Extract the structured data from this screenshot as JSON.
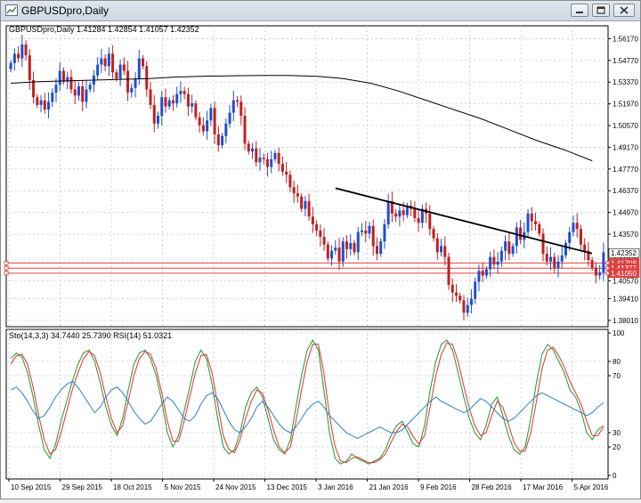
{
  "window": {
    "title": "GBPUSDpro,Daily",
    "controls": {
      "minimize": "minimize",
      "restore": "restore",
      "close": "close"
    }
  },
  "chart_data": [
    {
      "type": "candlestick",
      "symbol": "GBPUSDpro,Daily",
      "ohlc_label": "GBPUSDpro,Daily  1.41284 1.42854 1.41057 1.42352",
      "y_ticks": [
        "1.56170",
        "1.54770",
        "1.53370",
        "1.51970",
        "1.50570",
        "1.49170",
        "1.47770",
        "1.46370",
        "1.44970",
        "1.43570",
        "1.41970",
        "1.40570",
        "1.39410",
        "1.38010"
      ],
      "y_tick_values": [
        1.5617,
        1.5477,
        1.5337,
        1.5197,
        1.5057,
        1.4917,
        1.4777,
        1.4637,
        1.4497,
        1.4357,
        1.4197,
        1.4057,
        1.3941,
        1.3801
      ],
      "ylim": [
        1.376,
        1.57
      ],
      "x_ticks": [
        "10 Sep 2015",
        "29 Sep 2015",
        "18 Oct 2015",
        "5 Nov 2015",
        "24 Nov 2015",
        "13 Dec 2015",
        "3 Jan 2016",
        "21 Jan 2016",
        "9 Feb 2016",
        "28 Feb 2016",
        "17 Mar 2016",
        "5 Apr 2016"
      ],
      "price_labels": [
        {
          "text": "1.42352",
          "value": 1.42352,
          "color": "#000000"
        },
        {
          "text": "1.41708",
          "value": 1.41708,
          "color": "#e04040"
        },
        {
          "text": "1.41377",
          "value": 1.41377,
          "color": "#e04040"
        },
        {
          "text": "1.41050",
          "value": 1.4105,
          "color": "#e04040"
        }
      ],
      "horizontal_lines": [
        1.41708,
        1.41377,
        1.4105
      ],
      "trendline": {
        "from": {
          "x": "21 Jan 2016",
          "y": 1.4653
        },
        "to": {
          "x": "22 Apr 2016",
          "y": 1.4232
        }
      },
      "moving_average": [
        1.533,
        1.534,
        1.5345,
        1.535,
        1.5355,
        1.536,
        1.537,
        1.5375,
        1.5378,
        1.538,
        1.538,
        1.5375,
        1.536,
        1.533,
        1.528,
        1.522,
        1.516,
        1.51,
        1.503,
        1.496,
        1.49,
        1.483
      ],
      "closes": [
        1.546,
        1.552,
        1.549,
        1.558,
        1.551,
        1.535,
        1.524,
        1.519,
        1.522,
        1.516,
        1.521,
        1.527,
        1.532,
        1.541,
        1.534,
        1.537,
        1.529,
        1.525,
        1.531,
        1.521,
        1.529,
        1.532,
        1.538,
        1.545,
        1.549,
        1.544,
        1.552,
        1.54,
        1.536,
        1.545,
        1.541,
        1.527,
        1.53,
        1.536,
        1.549,
        1.544,
        1.529,
        1.519,
        1.507,
        1.512,
        1.524,
        1.518,
        1.522,
        1.52,
        1.526,
        1.528,
        1.526,
        1.518,
        1.52,
        1.511,
        1.506,
        1.502,
        1.509,
        1.517,
        1.5,
        1.493,
        1.499,
        1.507,
        1.514,
        1.522,
        1.521,
        1.512,
        1.494,
        1.489,
        1.491,
        1.482,
        1.485,
        1.484,
        1.479,
        1.484,
        1.488,
        1.481,
        1.476,
        1.474,
        1.466,
        1.462,
        1.46,
        1.452,
        1.457,
        1.447,
        1.442,
        1.438,
        1.434,
        1.429,
        1.42,
        1.425,
        1.427,
        1.418,
        1.431,
        1.426,
        1.43,
        1.424,
        1.437,
        1.438,
        1.436,
        1.441,
        1.428,
        1.423,
        1.431,
        1.442,
        1.457,
        1.449,
        1.447,
        1.451,
        1.448,
        1.454,
        1.452,
        1.446,
        1.443,
        1.452,
        1.449,
        1.439,
        1.433,
        1.424,
        1.428,
        1.421,
        1.403,
        1.398,
        1.396,
        1.393,
        1.385,
        1.39,
        1.394,
        1.405,
        1.412,
        1.409,
        1.413,
        1.421,
        1.416,
        1.418,
        1.425,
        1.431,
        1.423,
        1.428,
        1.44,
        1.432,
        1.437,
        1.449,
        1.444,
        1.442,
        1.436,
        1.423,
        1.418,
        1.421,
        1.414,
        1.418,
        1.422,
        1.43,
        1.437,
        1.443,
        1.439,
        1.429,
        1.425,
        1.419,
        1.414,
        1.409,
        1.411,
        1.424
      ],
      "x_start": "10 Sep 2015",
      "x_end": "22 Apr 2016"
    },
    {
      "type": "line",
      "indicator_label": "Sto(14,3,3) 34.7440 25.7390  RSI(14) 51.0321",
      "y_ticks": [
        "100",
        "80",
        "70",
        "30",
        "20",
        "0"
      ],
      "y_tick_values": [
        100,
        80,
        70,
        30,
        20,
        0
      ],
      "ylim": [
        0,
        100
      ],
      "series": [
        {
          "name": "Sto(14,3,3)",
          "color": "#1e9630",
          "values": [
            82,
            86,
            83,
            72,
            55,
            35,
            18,
            12,
            22,
            38,
            52,
            66,
            78,
            86,
            88,
            80,
            65,
            48,
            35,
            28,
            40,
            60,
            78,
            86,
            88,
            82,
            70,
            52,
            30,
            20,
            28,
            45,
            62,
            80,
            88,
            82,
            64,
            40,
            20,
            15,
            18,
            30,
            48,
            58,
            62,
            55,
            40,
            25,
            18,
            15,
            25,
            48,
            70,
            88,
            95,
            88,
            60,
            30,
            12,
            8,
            10,
            15,
            12,
            10,
            8,
            10,
            12,
            18,
            28,
            35,
            38,
            30,
            22,
            20,
            35,
            60,
            80,
            92,
            95,
            88,
            72,
            55,
            40,
            30,
            25,
            35,
            50,
            55,
            42,
            28,
            18,
            15,
            20,
            40,
            65,
            85,
            92,
            88,
            80,
            72,
            60,
            55,
            45,
            30,
            25,
            32,
            35
          ]
        },
        {
          "name": "Signal",
          "color": "#e03030",
          "values": [
            78,
            84,
            85,
            78,
            62,
            42,
            25,
            15,
            18,
            30,
            45,
            60,
            72,
            82,
            87,
            84,
            72,
            55,
            40,
            30,
            35,
            52,
            70,
            82,
            87,
            85,
            75,
            58,
            38,
            24,
            24,
            38,
            55,
            72,
            84,
            85,
            72,
            50,
            28,
            18,
            16,
            25,
            40,
            52,
            60,
            58,
            46,
            32,
            20,
            16,
            20,
            38,
            60,
            80,
            92,
            92,
            72,
            42,
            20,
            10,
            9,
            12,
            13,
            11,
            9,
            9,
            11,
            15,
            23,
            31,
            36,
            34,
            27,
            22,
            28,
            48,
            70,
            85,
            93,
            92,
            80,
            63,
            47,
            35,
            28,
            30,
            42,
            52,
            48,
            36,
            23,
            17,
            17,
            30,
            52,
            75,
            88,
            90,
            84,
            76,
            66,
            58,
            50,
            38,
            28,
            28,
            34
          ]
        },
        {
          "name": "RSI(14)",
          "color": "#2e7fc4",
          "values": [
            60,
            62,
            58,
            52,
            45,
            40,
            42,
            48,
            55,
            60,
            64,
            66,
            62,
            56,
            50,
            44,
            48,
            55,
            60,
            62,
            58,
            52,
            45,
            40,
            36,
            38,
            44,
            50,
            55,
            52,
            46,
            40,
            38,
            42,
            50,
            56,
            58,
            54,
            46,
            38,
            32,
            30,
            34,
            40,
            48,
            52,
            48,
            42,
            36,
            32,
            30,
            34,
            40,
            46,
            50,
            52,
            48,
            42,
            38,
            34,
            30,
            28,
            26,
            28,
            30,
            32,
            34,
            32,
            30,
            30,
            32,
            36,
            40,
            44,
            48,
            52,
            55,
            52,
            50,
            48,
            46,
            44,
            46,
            50,
            54,
            52,
            48,
            44,
            40,
            38,
            40,
            44,
            48,
            52,
            56,
            58,
            56,
            54,
            52,
            50,
            48,
            46,
            44,
            42,
            44,
            48,
            51
          ]
        }
      ]
    }
  ]
}
